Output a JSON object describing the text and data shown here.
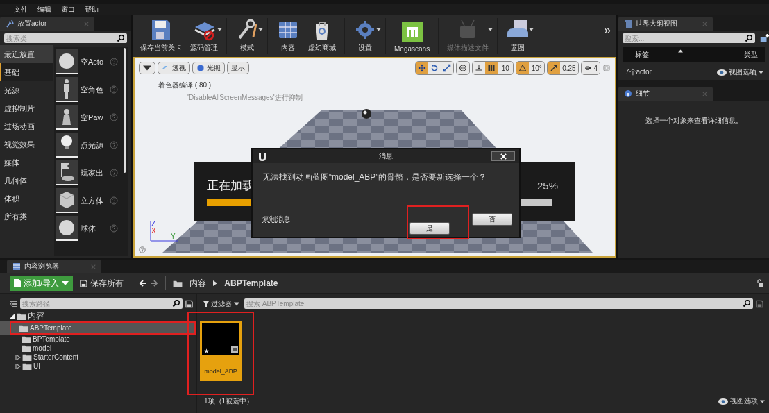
{
  "menu": [
    "文件",
    "编辑",
    "窗口",
    "帮助"
  ],
  "place_panel": {
    "tab": "放置actor",
    "search_placeholder": "搜索类",
    "categories": [
      {
        "label": "最近放置",
        "selected": false
      },
      {
        "label": "基础",
        "selected": true
      },
      {
        "label": "光源",
        "selected": false
      },
      {
        "label": "虚拟制片",
        "selected": false
      },
      {
        "label": "过场动画",
        "selected": false
      },
      {
        "label": "视觉效果",
        "selected": false
      },
      {
        "label": "媒体",
        "selected": false
      },
      {
        "label": "几何体",
        "selected": false
      },
      {
        "label": "体积",
        "selected": false
      },
      {
        "label": "所有类",
        "selected": false
      }
    ],
    "items": [
      {
        "label": "空Acto",
        "kind": "sphere"
      },
      {
        "label": "空角色",
        "kind": "figure"
      },
      {
        "label": "空Paw",
        "kind": "pawn"
      },
      {
        "label": "点光源",
        "kind": "bulb"
      },
      {
        "label": "玩家出",
        "kind": "flag"
      },
      {
        "label": "立方体",
        "kind": "cube"
      },
      {
        "label": "球体",
        "kind": "sphere"
      }
    ]
  },
  "toolbar": {
    "buttons": [
      {
        "label": "保存当前关卡",
        "kind": "save",
        "dropdown": false,
        "disabled": false
      },
      {
        "label": "源码管理",
        "kind": "source",
        "dropdown": true,
        "disabled": false
      },
      {
        "label": "模式",
        "kind": "mode",
        "dropdown": true,
        "disabled": false
      },
      {
        "label": "内容",
        "kind": "content",
        "dropdown": false,
        "disabled": false
      },
      {
        "label": "虚幻商城",
        "kind": "market",
        "dropdown": false,
        "disabled": false
      },
      {
        "label": "设置",
        "kind": "settings",
        "dropdown": true,
        "disabled": false
      },
      {
        "label": "Megascans",
        "kind": "megascans",
        "dropdown": false,
        "disabled": false
      },
      {
        "label": "媒体描述文件",
        "kind": "media",
        "dropdown": true,
        "disabled": true
      },
      {
        "label": "蓝图",
        "kind": "blueprint",
        "dropdown": true,
        "disabled": false
      }
    ],
    "overflow": "»"
  },
  "viewport": {
    "view_buttons": [
      "透视",
      "光照",
      "显示"
    ],
    "transform_tools": [
      {
        "kind": "move",
        "selected": true
      },
      {
        "kind": "rotate",
        "selected": false
      },
      {
        "kind": "scale",
        "selected": false
      }
    ],
    "snaps": [
      {
        "kind": "grid",
        "on": true,
        "value": "10"
      },
      {
        "kind": "angle",
        "on": true,
        "value": "10°"
      },
      {
        "kind": "scale",
        "on": true,
        "value": "0.25"
      }
    ],
    "camera_speed": "4",
    "messages": [
      "着色器编译 ( 80 )",
      "'DisableAllScreenMessages'进行抑制"
    ],
    "axes": [
      "Z",
      "X",
      "Y"
    ],
    "loading": {
      "text": "正在加载",
      "percent": "25%",
      "level": 0.25
    },
    "dialog": {
      "title": "消息",
      "message": "无法找到动画蓝图“model_ABP”的骨骼，是否要新选择一个？",
      "link": "复制消息",
      "buttons": [
        {
          "label": "是",
          "annotated": true
        },
        {
          "label": "否",
          "annotated": false
        }
      ]
    }
  },
  "outliner": {
    "tab": "世界大纲视图",
    "search_placeholder": "搜索...",
    "columns": [
      "标签",
      "类型"
    ],
    "count": "7个actor",
    "view_options": "视图选项"
  },
  "details": {
    "tab": "细节",
    "message": "选择一个对象来查看详细信息。"
  },
  "content_browser": {
    "tab": "内容浏览器",
    "add_button": "添加/导入",
    "save_all": "保存所有",
    "breadcrumbs": [
      "内容",
      "ABPTemplate"
    ],
    "path_search_placeholder": "搜索路径",
    "filter": "过滤器",
    "asset_search_placeholder": "搜索 ABPTemplate",
    "tree": [
      {
        "label": "内容",
        "expandable": true,
        "expanded": true,
        "selected": false,
        "annotated": false,
        "children": [
          {
            "label": "ABPTemplate",
            "expandable": false,
            "selected": true,
            "annotated": true
          },
          {
            "label": "BPTemplate",
            "expandable": false,
            "selected": false,
            "annotated": false
          },
          {
            "label": "model",
            "expandable": false,
            "selected": false,
            "annotated": false
          },
          {
            "label": "StarterContent",
            "expandable": true,
            "expanded": false,
            "selected": false,
            "annotated": false
          },
          {
            "label": "UI",
            "expandable": true,
            "expanded": false,
            "selected": false,
            "annotated": false
          }
        ]
      }
    ],
    "assets": [
      {
        "label": "model_ABP",
        "selected": true,
        "annotated": true
      }
    ],
    "status": "1项（1被选中）",
    "view_options": "视图选项"
  }
}
